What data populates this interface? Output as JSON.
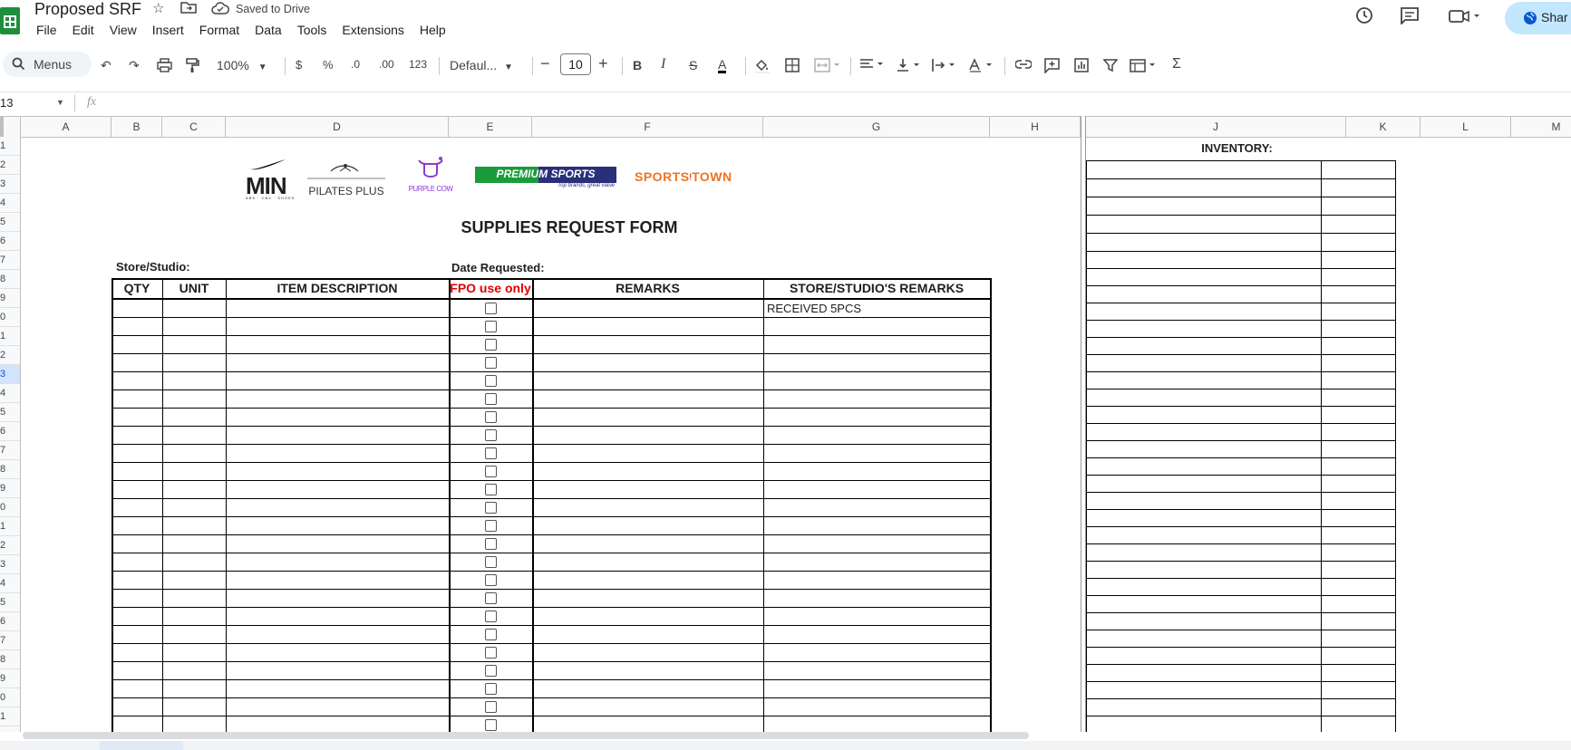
{
  "app": {
    "title": "Proposed SRF",
    "status": "Saved to Drive",
    "menu": [
      "File",
      "Edit",
      "View",
      "Insert",
      "Format",
      "Data",
      "Tools",
      "Extensions",
      "Help"
    ],
    "share_label": "Shar"
  },
  "toolbar": {
    "search_label": "Menus",
    "zoom": "100%",
    "currency": "$",
    "percent": "%",
    "dec_decrease": ".0",
    "dec_increase": ".00",
    "number_format": "123",
    "font": "Defaul...",
    "font_size": "10",
    "bold": "B",
    "italic": "I",
    "strike": "S",
    "text_color": "A",
    "sigma": "Σ"
  },
  "formula_bar": {
    "name_box": "13",
    "fx": "fx"
  },
  "columns": [
    "A",
    "B",
    "C",
    "D",
    "E",
    "F",
    "G",
    "H",
    "",
    "J",
    "K",
    "L",
    "M"
  ],
  "rows": [
    "1",
    "2",
    "3",
    "4",
    "5",
    "6",
    "7",
    "8",
    "9",
    "0",
    "1",
    "2",
    "3",
    "4",
    "5",
    "6",
    "7",
    "8",
    "9",
    "0",
    "1",
    "2",
    "3",
    "4",
    "5",
    "6",
    "7",
    "8",
    "9",
    "0",
    "1"
  ],
  "selected_row_index": 12,
  "brands": {
    "nike": "MIN",
    "nike_sub": "ABS · CBX · SHOES",
    "pilates": "PILATES PLUS",
    "purple_cow": "PURPLE COW",
    "premium": "PREMIUM SPORTS",
    "premium_sub": "Top brands, great value",
    "sports_town_a": "SPORTS",
    "sports_town_b": "TOWN"
  },
  "form": {
    "title": "SUPPLIES REQUEST FORM",
    "store_label": "Store/Studio:",
    "date_label": "Date Requested:",
    "headers": {
      "qty": "QTY",
      "unit": "UNIT",
      "item": "ITEM DESCRIPTION",
      "fpo": "FPO use only",
      "remarks": "REMARKS",
      "store_remarks": "STORE/STUDIO'S REMARKS"
    },
    "first_row_store_remark": "RECEIVED 5PCS",
    "fpo_color": "#e00000"
  },
  "inventory": {
    "title": "INVENTORY:"
  }
}
